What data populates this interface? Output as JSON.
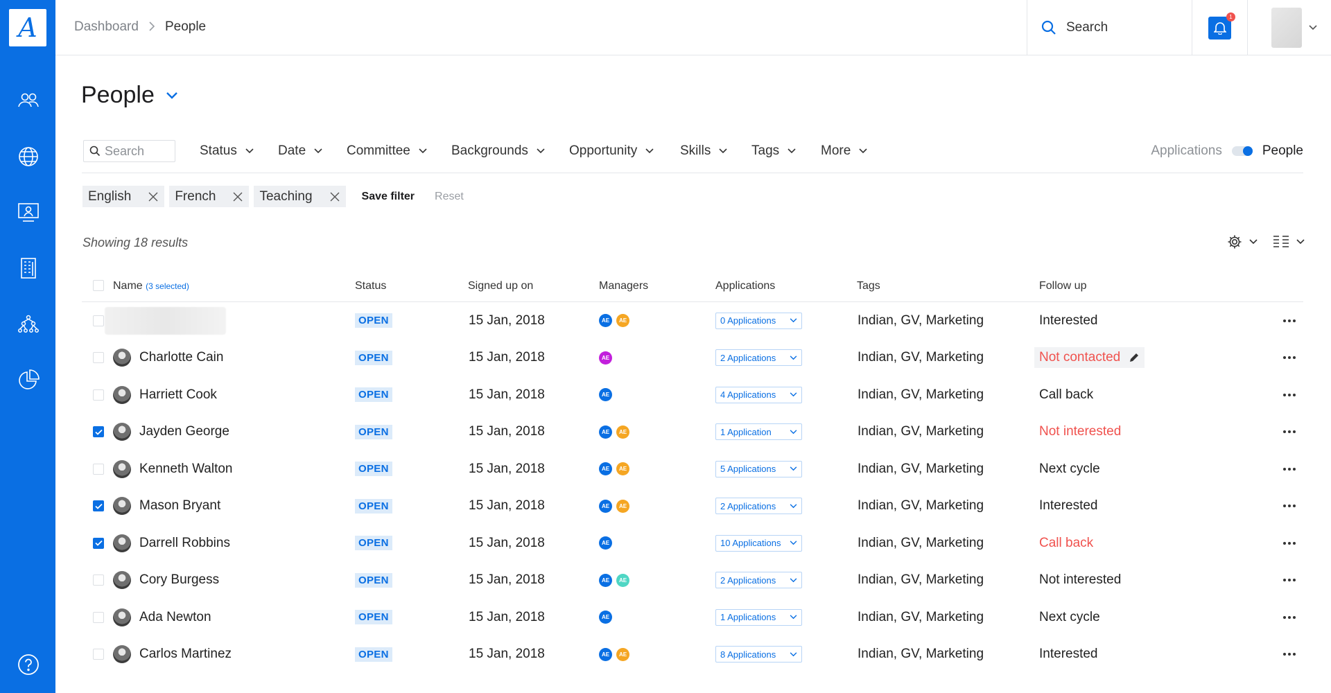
{
  "logo": {
    "letter": "A"
  },
  "sidebar": {
    "items": [
      {
        "icon": "people-icon"
      },
      {
        "icon": "globe-icon"
      },
      {
        "icon": "presentation-icon"
      },
      {
        "icon": "building-icon"
      },
      {
        "icon": "hierarchy-icon"
      },
      {
        "icon": "pie-chart-icon"
      }
    ],
    "help_icon": "help-icon"
  },
  "header": {
    "breadcrumb": {
      "root": "Dashboard",
      "current": "People"
    },
    "search_label": "Search",
    "notification_count": "1"
  },
  "page": {
    "title": "People"
  },
  "filters": {
    "search_placeholder": "Search",
    "dropdowns": [
      "Status",
      "Date",
      "Committee",
      "Backgrounds",
      "Opportunity",
      "Skills",
      "Tags",
      "More"
    ],
    "view_toggle": {
      "left": "Applications",
      "right": "People",
      "active": "People"
    }
  },
  "chips": [
    "English",
    "French",
    "Teaching"
  ],
  "actions": {
    "save_filter": "Save filter",
    "reset": "Reset"
  },
  "results": {
    "text": "Showing 18 results"
  },
  "table": {
    "columns": {
      "name": "Name",
      "selected_note": "(3 selected)",
      "status": "Status",
      "signed_up": "Signed up on",
      "managers": "Managers",
      "applications": "Applications",
      "tags": "Tags",
      "follow_up": "Follow up"
    },
    "rows": [
      {
        "name": "",
        "checked": false,
        "status": "OPEN",
        "signed_up": "15 Jan, 2018",
        "managers": [
          {
            "initials": "AE",
            "color": "#0a6fe3"
          },
          {
            "initials": "AE",
            "color": "#f5a623"
          }
        ],
        "applications": "0 Applications",
        "tags": "Indian, GV, Marketing",
        "follow_up": "Interested",
        "follow_up_color": "#222222",
        "follow_up_editing": false
      },
      {
        "name": "Charlotte Cain",
        "checked": false,
        "status": "OPEN",
        "signed_up": "15 Jan, 2018",
        "managers": [
          {
            "initials": "AE",
            "color": "#c21fdc"
          }
        ],
        "applications": "2 Applications",
        "tags": "Indian, GV, Marketing",
        "follow_up": "Not contacted",
        "follow_up_color": "#f0524e",
        "follow_up_editing": true
      },
      {
        "name": "Harriett Cook",
        "checked": false,
        "status": "OPEN",
        "signed_up": "15 Jan, 2018",
        "managers": [
          {
            "initials": "AE",
            "color": "#0a6fe3"
          }
        ],
        "applications": "4 Applications",
        "tags": "Indian, GV, Marketing",
        "follow_up": "Call back",
        "follow_up_color": "#222222",
        "follow_up_editing": false
      },
      {
        "name": "Jayden George",
        "checked": true,
        "status": "OPEN",
        "signed_up": "15 Jan, 2018",
        "managers": [
          {
            "initials": "AE",
            "color": "#0a6fe3"
          },
          {
            "initials": "AE",
            "color": "#f5a623"
          }
        ],
        "applications": "1 Application",
        "tags": "Indian, GV, Marketing",
        "follow_up": "Not interested",
        "follow_up_color": "#f0524e",
        "follow_up_editing": false
      },
      {
        "name": "Kenneth Walton",
        "checked": false,
        "status": "OPEN",
        "signed_up": "15 Jan, 2018",
        "managers": [
          {
            "initials": "AE",
            "color": "#0a6fe3"
          },
          {
            "initials": "AE",
            "color": "#f5a623"
          }
        ],
        "applications": "5 Applications",
        "tags": "Indian, GV, Marketing",
        "follow_up": "Next cycle",
        "follow_up_color": "#222222",
        "follow_up_editing": false
      },
      {
        "name": "Mason Bryant",
        "checked": true,
        "status": "OPEN",
        "signed_up": "15 Jan, 2018",
        "managers": [
          {
            "initials": "AE",
            "color": "#0a6fe3"
          },
          {
            "initials": "AE",
            "color": "#f5a623"
          }
        ],
        "applications": "2 Applications",
        "tags": "Indian, GV, Marketing",
        "follow_up": "Interested",
        "follow_up_color": "#222222",
        "follow_up_editing": false
      },
      {
        "name": "Darrell Robbins",
        "checked": true,
        "status": "OPEN",
        "signed_up": "15 Jan, 2018",
        "managers": [
          {
            "initials": "AE",
            "color": "#0a6fe3"
          }
        ],
        "applications": "10 Applications",
        "tags": "Indian, GV, Marketing",
        "follow_up": "Call back",
        "follow_up_color": "#f0524e",
        "follow_up_editing": false
      },
      {
        "name": "Cory Burgess",
        "checked": false,
        "status": "OPEN",
        "signed_up": "15 Jan, 2018",
        "managers": [
          {
            "initials": "AE",
            "color": "#0a6fe3"
          },
          {
            "initials": "AE",
            "color": "#4fd6c4"
          }
        ],
        "applications": "2 Applications",
        "tags": "Indian, GV, Marketing",
        "follow_up": "Not interested",
        "follow_up_color": "#222222",
        "follow_up_editing": false
      },
      {
        "name": "Ada Newton",
        "checked": false,
        "status": "OPEN",
        "signed_up": "15 Jan, 2018",
        "managers": [
          {
            "initials": "AE",
            "color": "#0a6fe3"
          }
        ],
        "applications": "1 Applications",
        "tags": "Indian, GV, Marketing",
        "follow_up": "Next cycle",
        "follow_up_color": "#222222",
        "follow_up_editing": false
      },
      {
        "name": "Carlos Martinez",
        "checked": false,
        "status": "OPEN",
        "signed_up": "15 Jan, 2018",
        "managers": [
          {
            "initials": "AE",
            "color": "#0a6fe3"
          },
          {
            "initials": "AE",
            "color": "#f5a623"
          }
        ],
        "applications": "8 Applications",
        "tags": "Indian, GV, Marketing",
        "follow_up": "Interested",
        "follow_up_color": "#222222",
        "follow_up_editing": false
      }
    ]
  },
  "colors": {
    "brand": "#0a6fe3",
    "danger": "#f0524e",
    "badge_bg": "#dcebfa"
  }
}
